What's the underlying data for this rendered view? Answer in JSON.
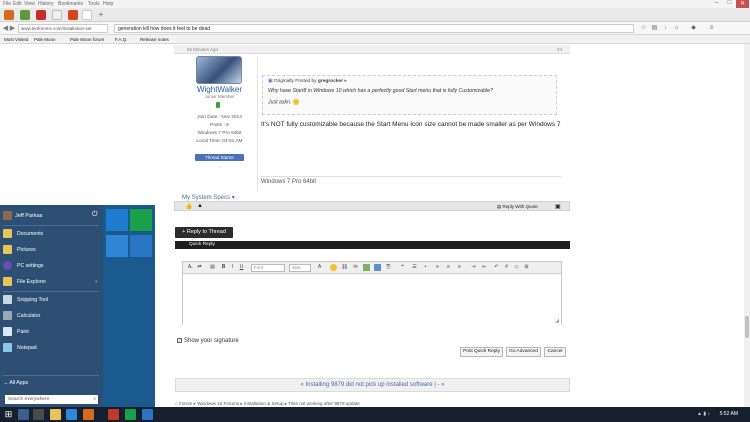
{
  "menubar": {
    "items": [
      "File",
      "Edit",
      "View",
      "History",
      "Bookmarks",
      "Tools",
      "Help"
    ]
  },
  "window": {
    "minimize": "–",
    "maximize": "□",
    "close": "✕"
  },
  "tabs": {
    "add": "+"
  },
  "address": {
    "url": "www.tenforums.com/installation-set",
    "search": "generation kill how does it feel to be dead"
  },
  "bookmarks": [
    "Most Visited",
    "Pale Moon",
    "Pale Moon forum",
    "F.A.Q.",
    "Release notes"
  ],
  "post": {
    "time": "56 Minutes Ago",
    "number": "#4",
    "user": {
      "name": "WightWalker",
      "rank": "Junior Member",
      "join": "Join Date : Nov 2014",
      "posts": "Posts : 6",
      "os": "Windows 7 Pro 64bit",
      "local_time": "Local Time: 04:51 AM",
      "badge": "Thread Starter"
    },
    "quote": {
      "by_prefix": "Originally Posted by",
      "by_user": "gregrocker",
      "line1": "Why have Start8 in Windows 10 which has a perfectly good Start menu that is fully Customizable?",
      "line2": "Just askn."
    },
    "text": "It's NOT fully customizable because the Start Menu Icon size cannot be made smaller as per Windows 7",
    "signature": "Windows 7 Pro 64bit",
    "system_specs": "My System Specs",
    "reply_with_quote": "Reply With Quote"
  },
  "reply_to_thread": "+ Reply to Thread",
  "quick_reply": "Quick Reply",
  "editor": {
    "font": "Font",
    "size": "Size"
  },
  "show_signature": "Show your signature",
  "buttons": {
    "post": "Post Quick Reply",
    "advanced": "Go Advanced",
    "cancel": "Cancel"
  },
  "prevnext": "« Installing 9879 did not pick up installed software | - »",
  "breadcrumbs": "Forum  ▸  Windows 10 Forums  ▸  Installation & Setup  ▸  Tiles not working after 9879 update",
  "startmenu": {
    "user": "Jeff Parkas",
    "items": [
      "Documents",
      "Pictures",
      "PC settings",
      "File Explorer",
      "Snipping Tool",
      "Calculator",
      "Paint",
      "Notepad"
    ],
    "all_apps": "All Apps",
    "search_placeholder": "Search everywhere"
  },
  "taskbar": {
    "time": "5:52 AM"
  },
  "colors": {
    "accent": "#1a5a8e",
    "link": "#2f5c9b",
    "bar": "#1f1f1f"
  }
}
